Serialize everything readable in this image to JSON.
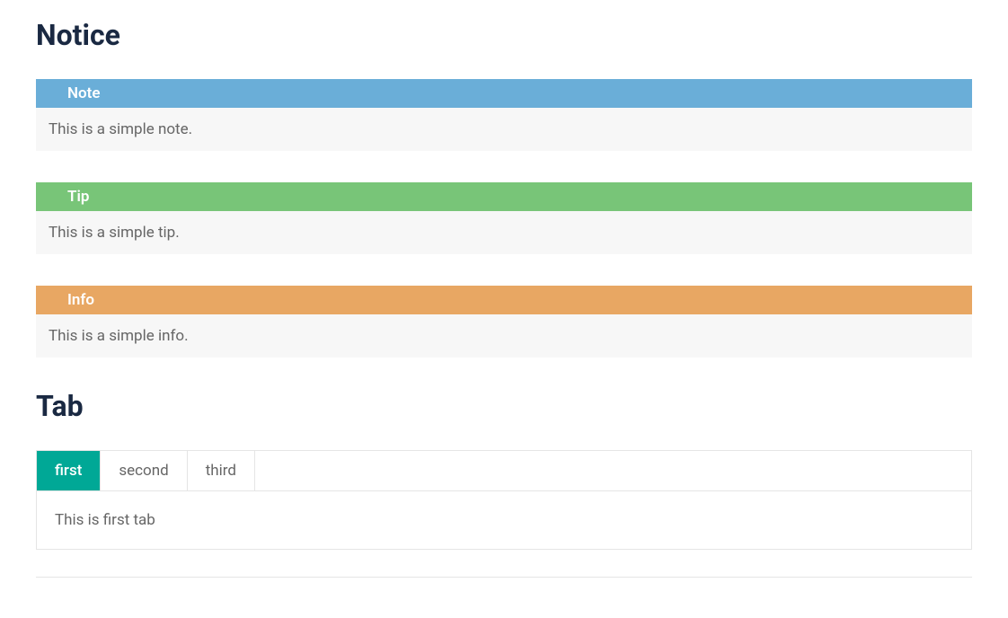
{
  "headings": {
    "notice": "Notice",
    "tab": "Tab"
  },
  "notices": {
    "note": {
      "title": "Note",
      "body": "This is a simple note."
    },
    "tip": {
      "title": "Tip",
      "body": "This is a simple tip."
    },
    "info": {
      "title": "Info",
      "body": "This is a simple info."
    }
  },
  "tabs": {
    "items": [
      {
        "label": "first",
        "active": true
      },
      {
        "label": "second",
        "active": false
      },
      {
        "label": "third",
        "active": false
      }
    ],
    "content": "This is first tab"
  }
}
